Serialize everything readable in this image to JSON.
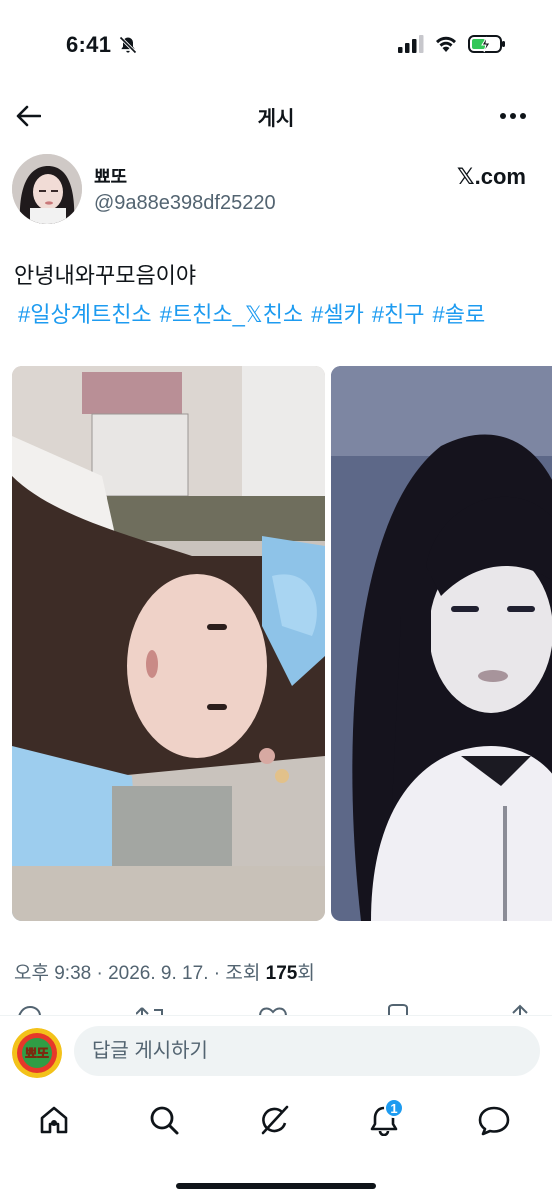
{
  "status_bar": {
    "time": "6:41",
    "battery_level": 0.5
  },
  "header": {
    "title": "게시"
  },
  "author": {
    "display_name": "뾰또",
    "handle": "@9a88e398df25220",
    "source": "𝕏.com"
  },
  "tweet": {
    "text": "안녕내와꾸모음이야",
    "hashtags": [
      "#일상계트친소",
      "#트친소_𝕏친소",
      "#셀카",
      "#친구",
      "#솔로"
    ]
  },
  "meta": {
    "time": "오후 9:38",
    "separator": "·",
    "date": "2026. 9. 17.",
    "views_prefix": "조회",
    "views_count": "175",
    "views_suffix": "회"
  },
  "reply": {
    "placeholder": "답글 게시하기",
    "avatar_text": "뾰또"
  },
  "tabs": {
    "notifications_badge": "1"
  },
  "colors": {
    "accent": "#1d9bf0",
    "text": "#0f1419",
    "muted": "#536471"
  },
  "icons": [
    "back-arrow-icon",
    "more-icon",
    "home-icon",
    "search-icon",
    "grok-icon",
    "bell-icon",
    "messages-icon"
  ]
}
